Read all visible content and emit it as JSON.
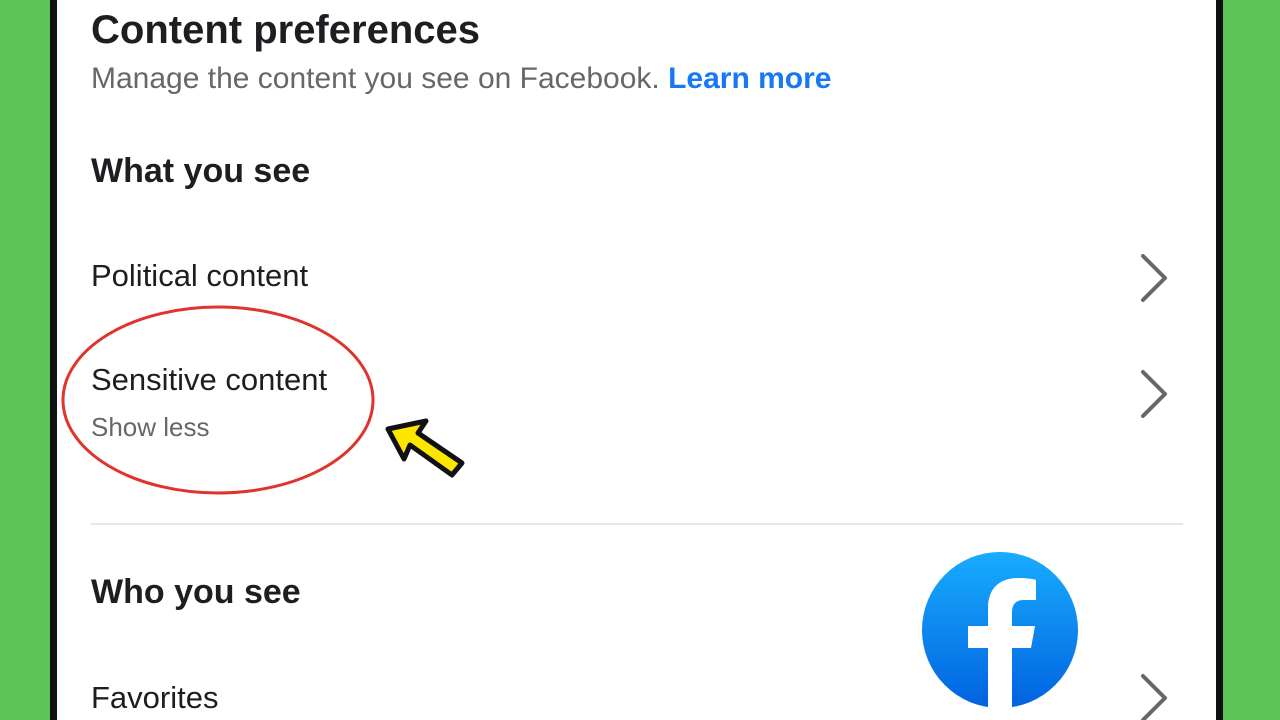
{
  "header": {
    "title": "Content preferences",
    "subtitle": "Manage the content you see on Facebook.",
    "learn_more": "Learn more"
  },
  "sections": {
    "what_you_see": {
      "heading": "What you see",
      "items": [
        {
          "label": "Political content"
        },
        {
          "label": "Sensitive content",
          "sub": "Show less"
        }
      ]
    },
    "who_you_see": {
      "heading": "Who you see",
      "items": [
        {
          "label": "Favorites"
        }
      ]
    }
  },
  "colors": {
    "background_green": "#5cc454",
    "link_blue": "#1877f2",
    "annotation_red": "#e0332b",
    "arrow_yellow": "#ffe600"
  },
  "icons": {
    "chevron": "chevron-right-icon",
    "logo": "facebook-logo-icon",
    "pointer": "yellow-arrow-pointer"
  }
}
